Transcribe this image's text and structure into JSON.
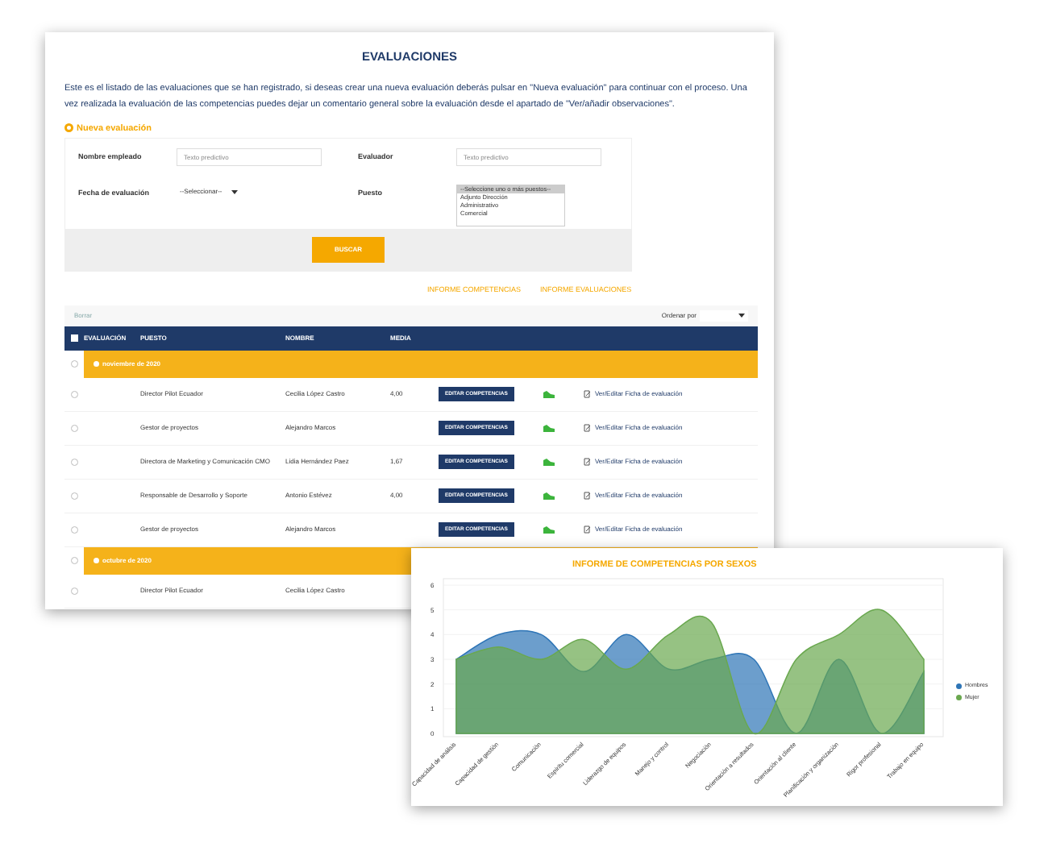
{
  "page": {
    "title": "EVALUACIONES",
    "intro": "Este es el listado de las evaluaciones que se han registrado, si deseas crear una nueva evaluación deberás pulsar en \"Nueva evaluación\" para continuar con el proceso. Una vez realizada la evaluación de las competencias puedes dejar un comentario general sobre la evaluación desde el apartado de \"Ver/añadir observaciones\".",
    "new_evaluation": "Nueva evaluación"
  },
  "form": {
    "fields": [
      {
        "kind": "text",
        "label": "Nombre empleado",
        "placeholder": "Texto predictivo"
      },
      {
        "kind": "text",
        "label": "Evaluador",
        "placeholder": "Texto predictivo"
      },
      {
        "kind": "select",
        "label": "Fecha de evaluación",
        "value": "--Seleccionar--"
      },
      {
        "kind": "list",
        "label": "Puesto",
        "options": [
          {
            "label": "--Seleccione uno o más puestos--",
            "selected": true
          },
          {
            "label": "Adjunto Dirección",
            "selected": false
          },
          {
            "label": "Administrativo",
            "selected": false
          },
          {
            "label": "Comercial",
            "selected": false
          }
        ]
      }
    ],
    "button": "BUSCAR"
  },
  "reports": [
    "INFORME COMPETENCIAS",
    "INFORME EVALUACIONES"
  ],
  "filter": {
    "clear": "Borrar",
    "sort_label": "Ordenar por"
  },
  "table": {
    "select_all": {
      "checked": false
    },
    "columns": [
      "EVALUACIÓN",
      "PUESTO",
      "NOMBRE",
      "MEDIA"
    ],
    "groups": [
      {
        "label": "noviembre de 2020",
        "selected": false,
        "rows": [
          {
            "selected": false,
            "puesto": "Director Pilot Ecuador",
            "nombre": "Cecilia López Castro",
            "media": "4,00",
            "button": "EDITAR COMPETENCIAS",
            "link": "Ver/Editar Ficha de evaluación"
          },
          {
            "selected": false,
            "puesto": "Gestor de proyectos",
            "nombre": "Alejandro Marcos",
            "button": "EDITAR COMPETENCIAS",
            "link": "Ver/Editar Ficha de evaluación"
          },
          {
            "selected": false,
            "puesto": "Directora de Marketing y Comunicación CMO",
            "nombre": "Lidia Hernández Paez",
            "media": "1,67",
            "button": "EDITAR COMPETENCIAS",
            "link": "Ver/Editar Ficha de evaluación"
          },
          {
            "selected": false,
            "puesto": "Responsable de Desarrollo y Soporte",
            "nombre": "Antonio Estévez",
            "media": "4,00",
            "button": "EDITAR COMPETENCIAS",
            "link": "Ver/Editar Ficha de evaluación"
          },
          {
            "selected": false,
            "puesto": "Gestor de proyectos",
            "nombre": "Alejandro Marcos",
            "button": "EDITAR COMPETENCIAS",
            "link": "Ver/Editar Ficha de evaluación"
          }
        ]
      },
      {
        "label": "octubre de 2020",
        "selected": false,
        "rows": [
          {
            "selected": false,
            "puesto": "Director Pilot Ecuador",
            "nombre": "Cecilia López Castro"
          }
        ]
      }
    ]
  },
  "chart": {
    "chart_data": {
      "type": "area",
      "title": "INFORME DE COMPETENCIAS POR SEXOS",
      "categories": [
        "Capacidad de análisis",
        "Capacidad de gestión",
        "Comunicación",
        "Espíritu comercial",
        "Liderazgo de equipos",
        "Manejo y control",
        "Negociación",
        "Orientación a resultados",
        "Orientación al cliente",
        "Planificación y organización",
        "Rigor profesional",
        "Trabajo en equipo"
      ],
      "series": [
        {
          "name": "Hombres",
          "color": "#2e75b6",
          "values": [
            3,
            4,
            4,
            2.5,
            4,
            2.6,
            3,
            3,
            0,
            3,
            0,
            2.5
          ]
        },
        {
          "name": "Mujer",
          "color": "#6aa84f",
          "values": [
            3,
            3.5,
            3,
            3.8,
            2.6,
            4,
            4.5,
            0,
            3,
            4,
            5,
            3
          ]
        }
      ],
      "ylim": [
        0,
        6
      ],
      "grid": true,
      "yticks": [
        0,
        1,
        2,
        3,
        4,
        5,
        6
      ]
    }
  }
}
